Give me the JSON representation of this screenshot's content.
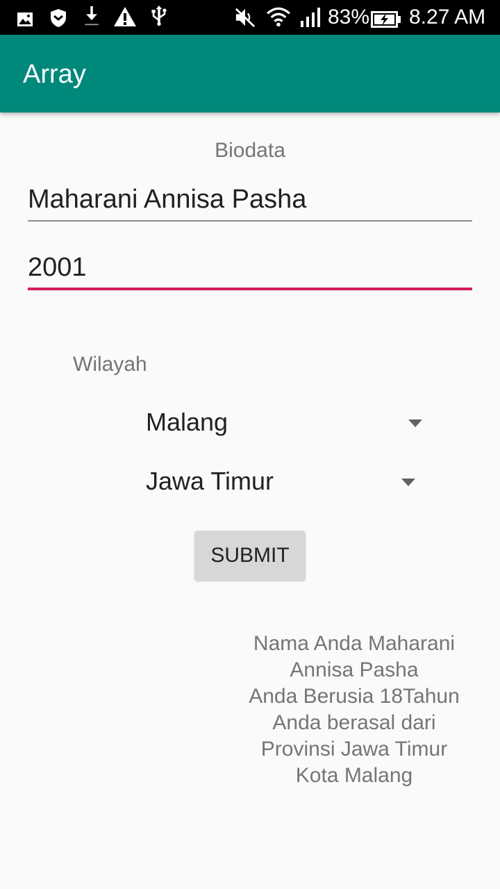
{
  "status_bar": {
    "battery_percent": "83%",
    "time": "8.27 AM",
    "icons": [
      "gallery-icon",
      "shield-icon",
      "download-icon",
      "warning-icon",
      "usb-icon",
      "mute-icon",
      "wifi-icon",
      "signal-icon",
      "battery-charging-icon"
    ]
  },
  "app_bar": {
    "title": "Array",
    "color": "#00897b"
  },
  "form": {
    "heading": "Biodata",
    "name_value": "Maharani Annisa Pasha",
    "year_value": "2001",
    "accent_color": "#d81b60",
    "region_label": "Wilayah",
    "city_spinner": {
      "selected": "Malang"
    },
    "province_spinner": {
      "selected": "Jawa Timur"
    },
    "submit_label": "SUBMIT"
  },
  "result": {
    "lines": [
      "Nama Anda Maharani",
      "Annisa Pasha",
      "Anda Berusia 18Tahun",
      "Anda berasal dari",
      "Provinsi Jawa Timur",
      "Kota Malang"
    ]
  }
}
